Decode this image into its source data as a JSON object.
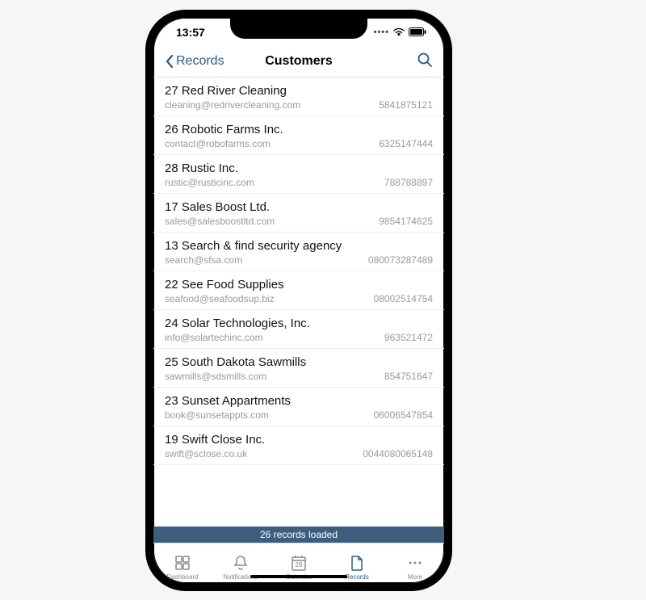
{
  "status": {
    "time": "13:57"
  },
  "nav": {
    "back_label": "Records",
    "title": "Customers"
  },
  "customers": [
    {
      "id": "27",
      "name": "Red River Cleaning",
      "email": "cleaning@redrivercleaning.com",
      "phone": "5841875121"
    },
    {
      "id": "26",
      "name": "Robotic Farms Inc.",
      "email": "contact@robofarms.com",
      "phone": "6325147444"
    },
    {
      "id": "28",
      "name": "Rustic Inc.",
      "email": "rustic@rusticinc.com",
      "phone": "788788897"
    },
    {
      "id": "17",
      "name": "Sales Boost Ltd.",
      "email": "sales@salesboostltd.com",
      "phone": "9854174625"
    },
    {
      "id": "13",
      "name": "Search & find security agency",
      "email": "search@sfsa.com",
      "phone": "080073287489"
    },
    {
      "id": "22",
      "name": "See Food Supplies",
      "email": "seafood@seafoodsup.biz",
      "phone": "08002514754"
    },
    {
      "id": "24",
      "name": "Solar Technologies, Inc.",
      "email": "info@solartechinc.com",
      "phone": "963521472"
    },
    {
      "id": "25",
      "name": "South Dakota Sawmills",
      "email": "sawmills@sdsmills.com",
      "phone": "854751647"
    },
    {
      "id": "23",
      "name": "Sunset Appartments",
      "email": "book@sunsetappts.com",
      "phone": "06006547854"
    },
    {
      "id": "19",
      "name": "Swift Close Inc.",
      "email": "swift@sclose.co.uk",
      "phone": "0044080065148"
    }
  ],
  "footer_status": "26 records loaded",
  "tabs": [
    {
      "label": "Dashboard"
    },
    {
      "label": "Notifications"
    },
    {
      "label": "Calendar",
      "day": "28"
    },
    {
      "label": "Records"
    },
    {
      "label": "More"
    }
  ],
  "active_tab_index": 3
}
